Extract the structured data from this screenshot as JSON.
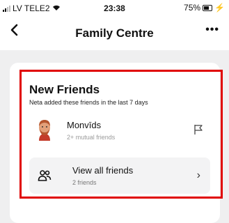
{
  "status_bar": {
    "carrier": "LV TELE2",
    "time": "23:38",
    "battery": "75%"
  },
  "nav": {
    "back_icon": "chevron-left-icon",
    "title": "Family Centre",
    "more_icon": "more-icon",
    "more_label": "•••"
  },
  "section": {
    "title": "New Friends",
    "subtitle": "Neta added these friends in the last 7 days"
  },
  "friend": {
    "name": "Monvīds",
    "meta": "2+ mutual friends",
    "avatar_icon": "bitmoji-avatar-icon",
    "flag_icon": "flag-icon"
  },
  "view_all": {
    "label": "View all friends",
    "count": "2 friends",
    "icon": "people-icon",
    "chevron": "›"
  },
  "colors": {
    "highlight": "#e00000",
    "background": "#efeff0",
    "card": "#ffffff",
    "charging": "#3cc43c"
  }
}
